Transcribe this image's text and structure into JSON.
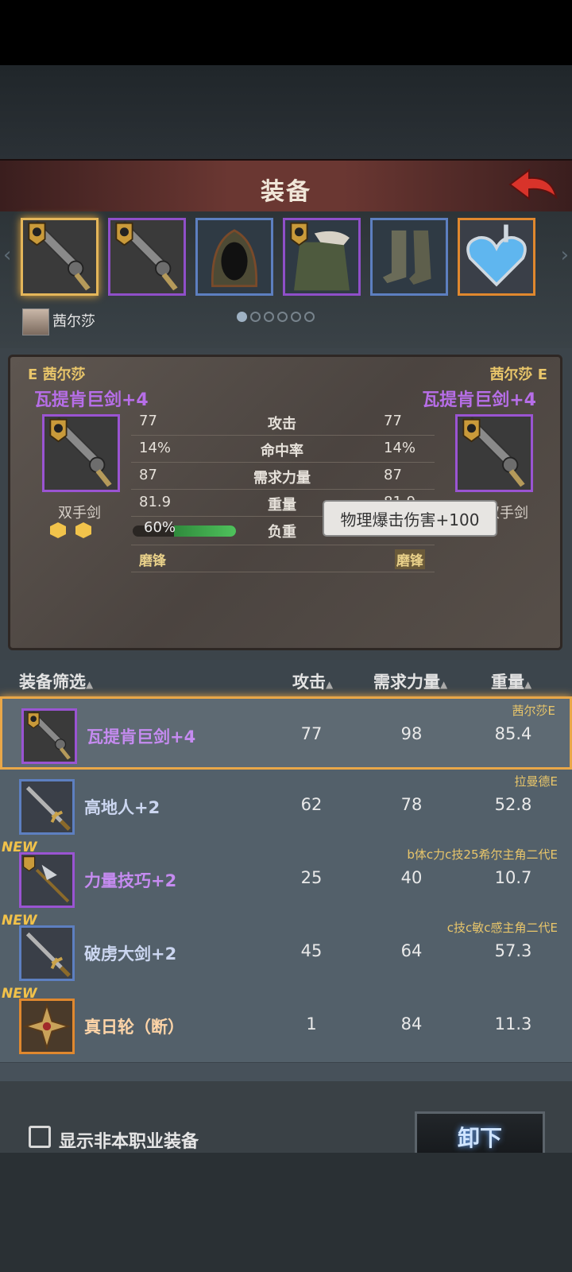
{
  "header": {
    "title": "装备"
  },
  "slots": [
    {
      "icon": "greatsword-icon",
      "frame": "sel"
    },
    {
      "icon": "greatsword-icon",
      "frame": "purple"
    },
    {
      "icon": "hood-icon",
      "frame": "blue"
    },
    {
      "icon": "fur-armor-icon",
      "frame": "purple"
    },
    {
      "icon": "boots-icon",
      "frame": "blue"
    },
    {
      "icon": "heart-amulet-icon",
      "frame": "orange"
    }
  ],
  "owner": {
    "name": "茜尔莎"
  },
  "page_dots": 6,
  "page_dot_active": 0,
  "compare": {
    "left": {
      "owner": "E 茜尔莎",
      "title": "瓦提肯巨剑+4",
      "type": "双手剑",
      "gems": 2,
      "skill": "磨锋"
    },
    "right": {
      "owner": "茜尔莎 E",
      "title": "瓦提肯巨剑+4",
      "type": "双手剑",
      "skill": "磨锋"
    },
    "stats": [
      {
        "name": "攻击",
        "left": "77",
        "right": "77"
      },
      {
        "name": "命中率",
        "left": "14%",
        "right": "14%"
      },
      {
        "name": "需求力量",
        "left": "87",
        "right": "87"
      },
      {
        "name": "重量",
        "left": "81.9",
        "right": "81.9"
      },
      {
        "name": "负重",
        "left": "60%",
        "right": ""
      }
    ],
    "load_fraction": 0.6,
    "tooltip": "物理爆击伤害+100"
  },
  "list": {
    "headers": {
      "filter": "装备筛选",
      "attack": "攻击",
      "str": "需求力量",
      "weight": "重量"
    },
    "rows": [
      {
        "name": "瓦提肯巨剑+4",
        "rarity": "purple",
        "icon": "greatsword-icon",
        "atk": "77",
        "str": "98",
        "wt": "85.4",
        "owner": "茜尔莎E",
        "new": false,
        "selected": true
      },
      {
        "name": "高地人+2",
        "rarity": "blue",
        "icon": "sword-icon",
        "atk": "62",
        "str": "78",
        "wt": "52.8",
        "owner": "拉曼德E",
        "new": false,
        "selected": false
      },
      {
        "name": "力量技巧+2",
        "rarity": "purple",
        "icon": "spear-icon",
        "atk": "25",
        "str": "40",
        "wt": "10.7",
        "owner": "b体c力c技25希尔主角二代E",
        "new": true,
        "selected": false
      },
      {
        "name": "破虏大剑+2",
        "rarity": "blue",
        "icon": "sword-icon",
        "atk": "45",
        "str": "64",
        "wt": "57.3",
        "owner": "c技c敏c感主角二代E",
        "new": true,
        "selected": false
      },
      {
        "name": "真日轮（断）",
        "rarity": "orange",
        "icon": "sunwheel-icon",
        "atk": "1",
        "str": "84",
        "wt": "11.3",
        "owner": "",
        "new": true,
        "selected": false
      }
    ],
    "new_label": "NEW"
  },
  "footer": {
    "checkbox_label": "显示非本职业装备",
    "unload": "卸下"
  }
}
